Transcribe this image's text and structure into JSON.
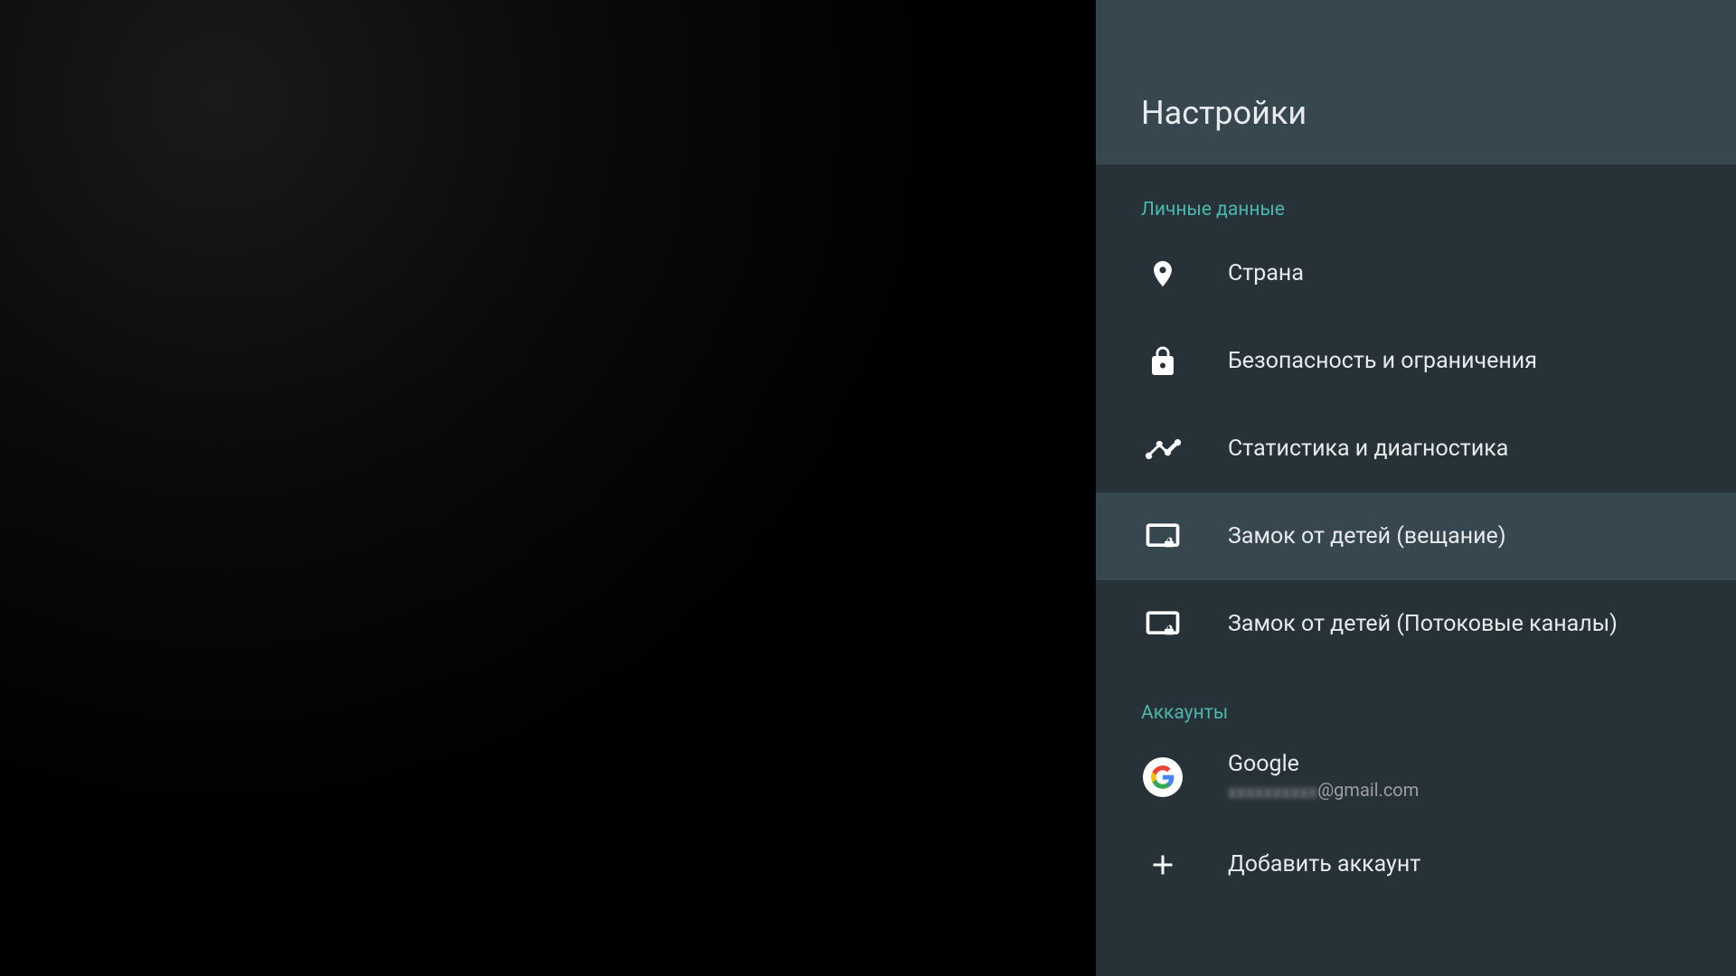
{
  "header": {
    "title": "Настройки"
  },
  "sections": {
    "personal": {
      "label": "Личные данные",
      "items": {
        "country": "Страна",
        "security": "Безопасность и ограничения",
        "stats": "Статистика и диагностика",
        "childlock_broadcast": "Замок от детей (вещание)",
        "childlock_streaming": "Замок от детей (Потоковые каналы)"
      }
    },
    "accounts": {
      "label": "Аккаунты",
      "items": {
        "google": {
          "title": "Google",
          "email_prefix": "xxxxxxxxxx",
          "email_suffix": "@gmail.com"
        },
        "add_account": "Добавить аккаунт"
      }
    }
  }
}
